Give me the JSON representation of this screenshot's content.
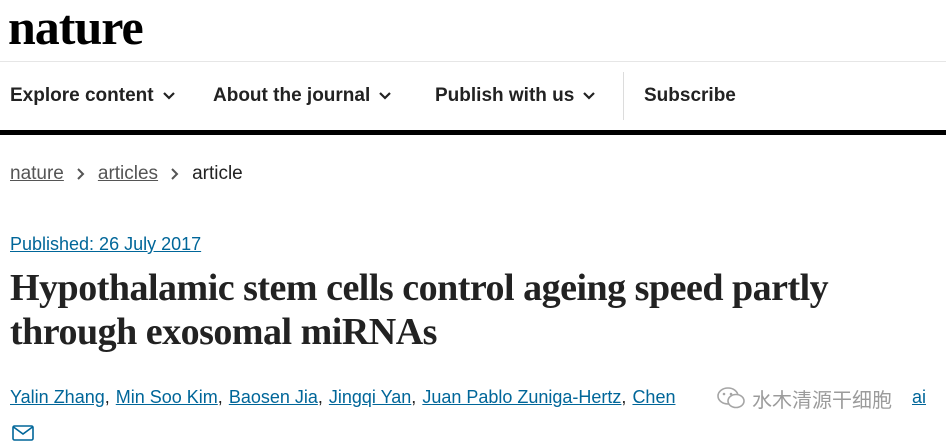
{
  "site": {
    "logo": "nature"
  },
  "nav": {
    "items": [
      {
        "label": "Explore content",
        "has_dropdown": true
      },
      {
        "label": "About the journal",
        "has_dropdown": true
      },
      {
        "label": "Publish with us",
        "has_dropdown": true
      },
      {
        "label": "Subscribe",
        "has_dropdown": false
      }
    ]
  },
  "breadcrumb": [
    {
      "label": "nature",
      "link": true
    },
    {
      "label": "articles",
      "link": true
    },
    {
      "label": "article",
      "link": false
    }
  ],
  "article": {
    "published": "Published: 26 July 2017",
    "title": "Hypothalamic stem cells control ageing speed partly through exosomal miRNAs",
    "authors": [
      "Yalin Zhang",
      "Min Soo Kim",
      "Baosen Jia",
      "Jingqi Yan",
      "Juan Pablo Zuniga-Hertz",
      "Chen"
    ],
    "authors_tail": "ai"
  },
  "watermark": {
    "text": "水木清源干细胞"
  },
  "colors": {
    "link": "#006699",
    "text": "#222222",
    "divider": "#000000"
  }
}
